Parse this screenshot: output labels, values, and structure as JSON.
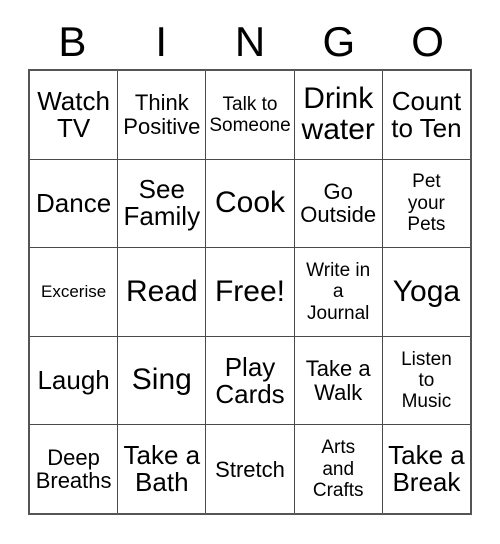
{
  "card": {
    "type": "bingo-card",
    "header_letters": [
      "B",
      "I",
      "N",
      "G",
      "O"
    ],
    "grid_size": "5x5",
    "text_color": "#000000",
    "background_color": "#ffffff",
    "border_color": "#4a4a4a",
    "rows": [
      [
        {
          "label": "Watch\nTV",
          "size": "lg"
        },
        {
          "label": "Think\nPositive",
          "size": "md"
        },
        {
          "label": "Talk to\nSomeone",
          "size": "sm"
        },
        {
          "label": "Drink\nwater",
          "size": "xl"
        },
        {
          "label": "Count\nto Ten",
          "size": "lg"
        }
      ],
      [
        {
          "label": "Dance",
          "size": "lg"
        },
        {
          "label": "See\nFamily",
          "size": "lg"
        },
        {
          "label": "Cook",
          "size": "xl"
        },
        {
          "label": "Go\nOutside",
          "size": "md"
        },
        {
          "label": "Pet\nyour\nPets",
          "size": "sm"
        }
      ],
      [
        {
          "label": "Excerise",
          "size": "xs"
        },
        {
          "label": "Read",
          "size": "xl"
        },
        {
          "label": "Free!",
          "size": "xl"
        },
        {
          "label": "Write in\na\nJournal",
          "size": "sm"
        },
        {
          "label": "Yoga",
          "size": "xl"
        }
      ],
      [
        {
          "label": "Laugh",
          "size": "lg"
        },
        {
          "label": "Sing",
          "size": "xl"
        },
        {
          "label": "Play\nCards",
          "size": "lg"
        },
        {
          "label": "Take a\nWalk",
          "size": "md"
        },
        {
          "label": "Listen\nto\nMusic",
          "size": "sm"
        }
      ],
      [
        {
          "label": "Deep\nBreaths",
          "size": "md"
        },
        {
          "label": "Take a\nBath",
          "size": "lg"
        },
        {
          "label": "Stretch",
          "size": "md"
        },
        {
          "label": "Arts\nand\nCrafts",
          "size": "sm"
        },
        {
          "label": "Take a\nBreak",
          "size": "lg"
        }
      ]
    ]
  }
}
